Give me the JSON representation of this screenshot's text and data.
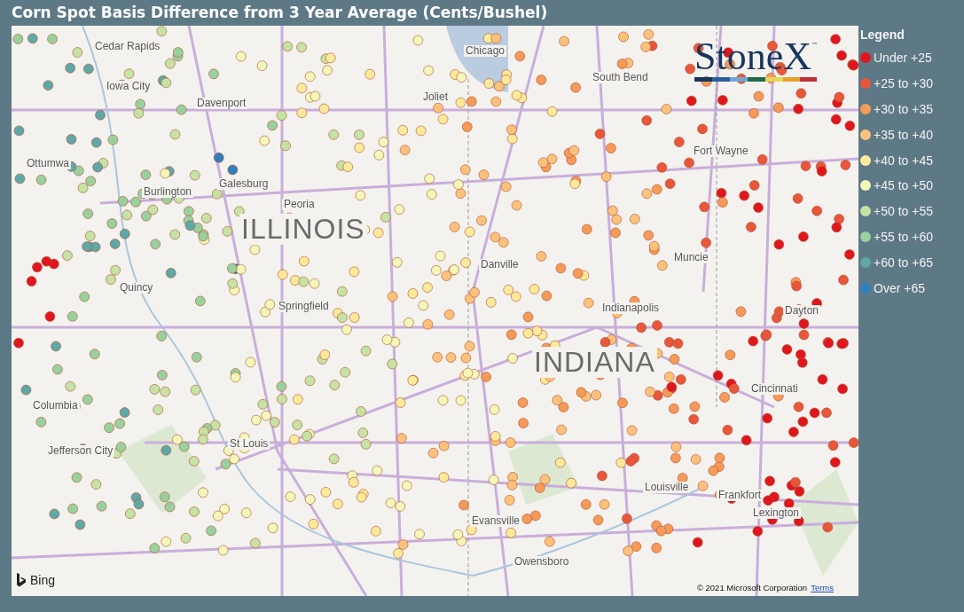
{
  "title": "Corn Spot Basis Difference from 3 Year Average (Cents/Bushel)",
  "map": {
    "labels": [
      {
        "text": "Cedar Rapids",
        "kind": "city"
      },
      {
        "text": "Iowa City",
        "kind": "city"
      },
      {
        "text": "Davenport",
        "kind": "city"
      },
      {
        "text": "Ottumwa",
        "kind": "city"
      },
      {
        "text": "Burlington",
        "kind": "city"
      },
      {
        "text": "Galesburg",
        "kind": "city"
      },
      {
        "text": "Peoria",
        "kind": "city"
      },
      {
        "text": "ILLINOIS",
        "kind": "state"
      },
      {
        "text": "Chicago",
        "kind": "city"
      },
      {
        "text": "Joliet",
        "kind": "city"
      },
      {
        "text": "South Bend",
        "kind": "city"
      },
      {
        "text": "Fort Wayne",
        "kind": "city"
      },
      {
        "text": "Muncie",
        "kind": "city"
      },
      {
        "text": "Danville",
        "kind": "city"
      },
      {
        "text": "Springfield",
        "kind": "city"
      },
      {
        "text": "Quincy",
        "kind": "city"
      },
      {
        "text": "Indianapolis",
        "kind": "city"
      },
      {
        "text": "Dayton",
        "kind": "city"
      },
      {
        "text": "INDIANA",
        "kind": "state"
      },
      {
        "text": "Cincinnati",
        "kind": "city"
      },
      {
        "text": "Columbia",
        "kind": "city"
      },
      {
        "text": "Jefferson City",
        "kind": "city"
      },
      {
        "text": "St Louis",
        "kind": "city"
      },
      {
        "text": "Louisville",
        "kind": "city"
      },
      {
        "text": "Frankfort",
        "kind": "city"
      },
      {
        "text": "Lexington",
        "kind": "city"
      },
      {
        "text": "Evansville",
        "kind": "city"
      },
      {
        "text": "Owensboro",
        "kind": "city"
      }
    ],
    "logo": {
      "name": "StoneX",
      "mark": "™"
    },
    "provider": "Bing",
    "copyright": "© 2021 Microsoft Corporation",
    "terms_link": "Terms"
  },
  "legend": {
    "title": "Legend",
    "items": [
      {
        "label": "Under +25",
        "color": "#e0161e"
      },
      {
        "label": "+25 to +30",
        "color": "#e8573a"
      },
      {
        "label": "+30 to +35",
        "color": "#f59a58"
      },
      {
        "label": "+35 to +40",
        "color": "#fcc27c"
      },
      {
        "label": "+40 to +45",
        "color": "#fde99a"
      },
      {
        "label": "+45 to +50",
        "color": "#f3f7b8"
      },
      {
        "label": "+50 to +55",
        "color": "#c5e3a4"
      },
      {
        "label": "+55 to +60",
        "color": "#99d19e"
      },
      {
        "label": "+60 to +65",
        "color": "#5fa8a8"
      },
      {
        "label": "Over +65",
        "color": "#2f7fbf"
      }
    ]
  }
}
